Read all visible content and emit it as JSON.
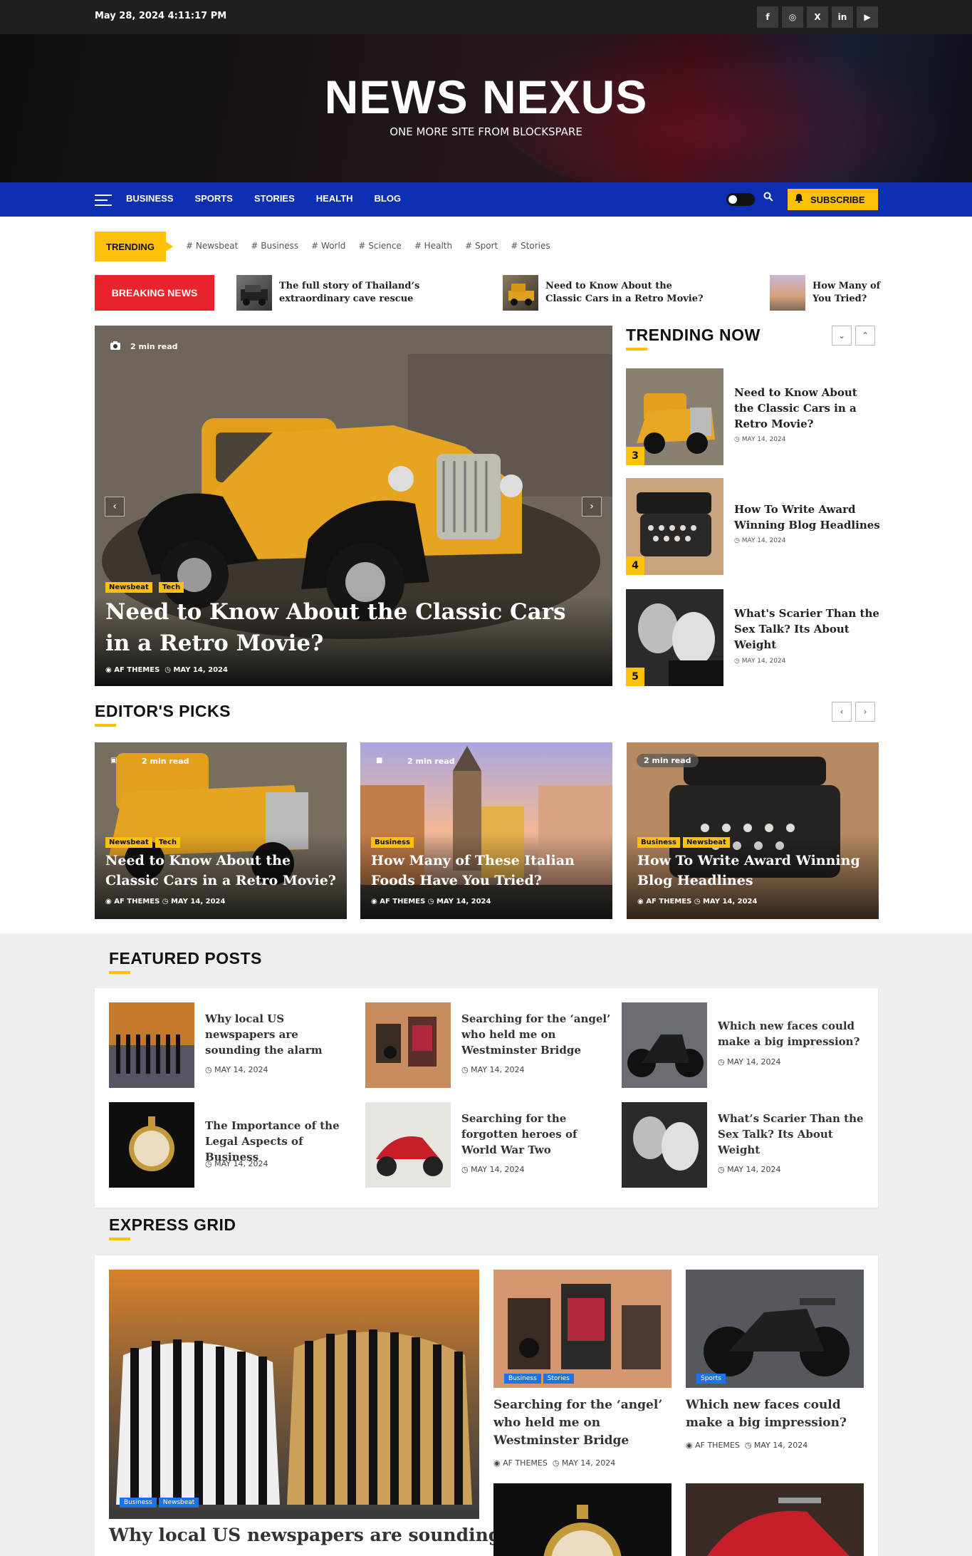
{
  "topbar": {
    "date": "May 28, 2024 4:11:17 PM",
    "socials": [
      {
        "icon": "facebook-icon",
        "glyph": "f"
      },
      {
        "icon": "instagram-icon",
        "glyph": "◎"
      },
      {
        "icon": "x-icon",
        "glyph": "X"
      },
      {
        "icon": "linkedin-icon",
        "glyph": "in"
      },
      {
        "icon": "youtube-icon",
        "glyph": "▶"
      }
    ]
  },
  "masthead": {
    "title": "NEWS NEXUS",
    "tagline": "ONE MORE SITE FROM BLOCKSPARE"
  },
  "nav": {
    "items": [
      "BUSINESS",
      "SPORTS",
      "STORIES",
      "HEALTH",
      "BLOG"
    ],
    "subscribe": "SUBSCRIBE",
    "accent": "#0b2fb0"
  },
  "trending": {
    "label": "TRENDING",
    "tags": [
      "# Newsbeat",
      "# Business",
      "# World",
      "# Science",
      "# Health",
      "# Sport",
      "# Stories"
    ]
  },
  "breaking": {
    "label": "BREAKING NEWS",
    "items": [
      "The full story of Thailand's extraordinary cave rescue",
      "Need to Know About the Classic Cars in a Retro Movie?",
      "How Many of These Italian Foods Have You Tried?"
    ],
    "visible_items": [
      "The full story of Thailand’s extraordinary cave rescue",
      "Need to Know About the Classic Cars in a Retro Movie?",
      "How Many of You Tried?"
    ]
  },
  "hero": {
    "read_time": "2 min read",
    "badges": [
      "Newsbeat",
      "Tech"
    ],
    "title": "Need to Know About the Classic Cars in a Retro Movie?",
    "author": "AF THEMES",
    "date": "MAY 14, 2024"
  },
  "trending_now": {
    "title": "TRENDING NOW",
    "items": [
      {
        "num": "3",
        "title": "Need to Know About the Classic Cars in a Retro Movie?",
        "date": "MAY 14, 2024"
      },
      {
        "num": "4",
        "title": "How To Write Award Winning Blog Headlines",
        "date": "MAY 14, 2024"
      },
      {
        "num": "5",
        "title": "What's Scarier Than the Sex Talk? Its About Weight",
        "date": "MAY 14, 2024"
      }
    ]
  },
  "editors_picks": {
    "title": "EDITOR'S PICKS",
    "items": [
      {
        "read": "2 min read",
        "badges": [
          "Newsbeat",
          "Tech"
        ],
        "title": "Need to Know About the Classic Cars in a Retro Movie?",
        "author": "AF THEMES",
        "date": "MAY 14, 2024"
      },
      {
        "read": "2 min read",
        "badges": [
          "Business"
        ],
        "title": "How Many of These Italian Foods Have You Tried?",
        "author": "AF THEMES",
        "date": "MAY 14, 2024"
      },
      {
        "read": "2 min read",
        "badges": [
          "Business",
          "Newsbeat"
        ],
        "title": "How To Write Award Winning Blog Headlines",
        "author": "AF THEMES",
        "date": "MAY 14, 2024"
      }
    ]
  },
  "featured": {
    "title": "FEATURED POSTS",
    "items": [
      {
        "title": "Why local US newspapers are sounding the alarm",
        "date": "MAY 14, 2024"
      },
      {
        "title": "Searching for the ‘angel’ who held me on Westminster Bridge",
        "date": "MAY 14, 2024"
      },
      {
        "title": "Which new faces could make a big impression?",
        "date": "MAY 14, 2024"
      },
      {
        "title": "The Importance of the Legal Aspects of Business",
        "date": "MAY 14, 2024"
      },
      {
        "title": "Searching for the forgotten heroes of World War Two",
        "date": "MAY 14, 2024"
      },
      {
        "title": "What’s Scarier Than the Sex Talk? Its About Weight",
        "date": "MAY 14, 2024"
      }
    ]
  },
  "express": {
    "title": "EXPRESS GRID",
    "main": {
      "badges": [
        "Business",
        "Newsbeat"
      ],
      "title": "Why local US newspapers are sounding"
    },
    "cards": [
      {
        "badges": [
          "Business",
          "Stories"
        ],
        "title": "Searching for the ‘angel’ who held me on Westminster Bridge",
        "author": "AF THEMES",
        "date": "MAY 14, 2024"
      },
      {
        "badges": [
          "Sports"
        ],
        "title": "Which new faces could make a big impression?",
        "author": "AF THEMES",
        "date": "MAY 14, 2024"
      }
    ]
  }
}
